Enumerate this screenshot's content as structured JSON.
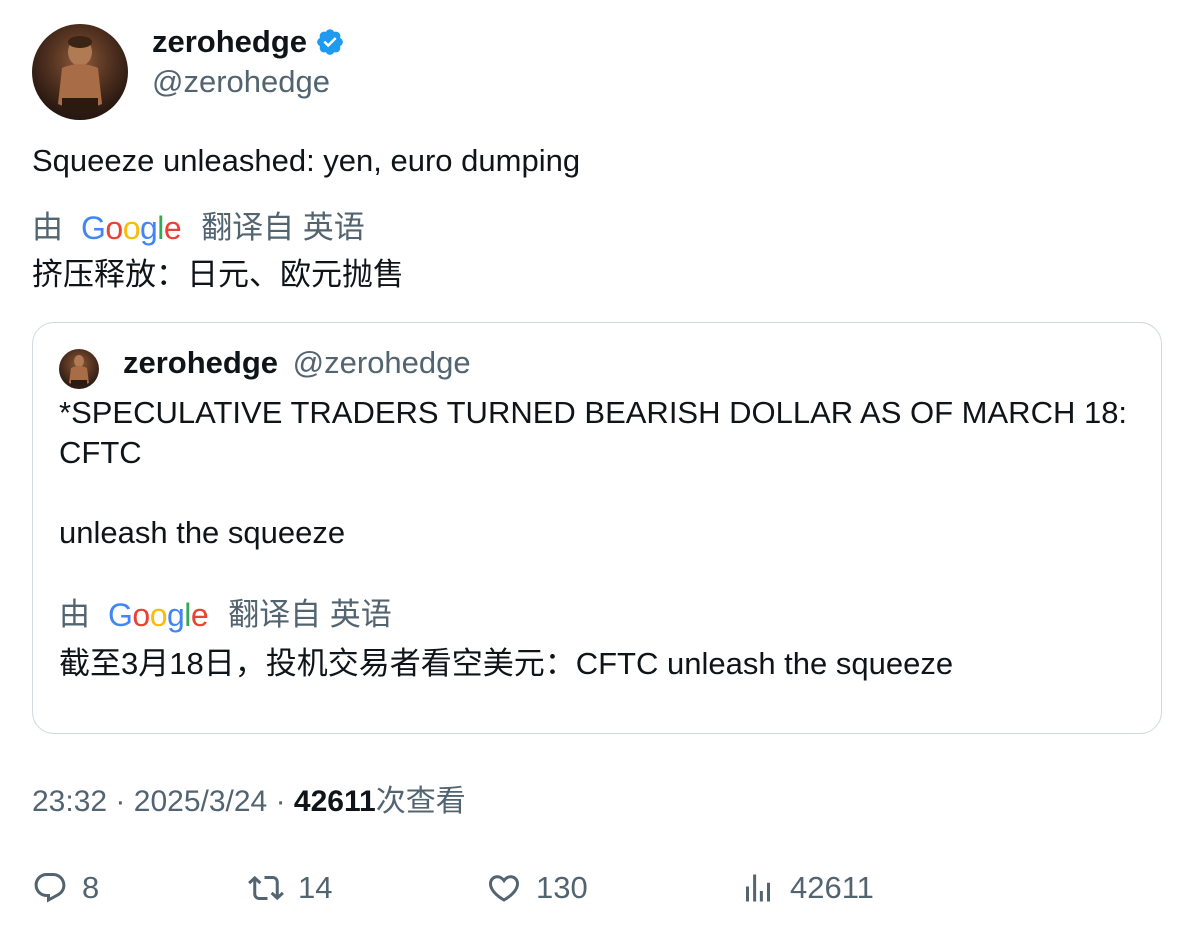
{
  "author": {
    "name": "zerohedge",
    "handle": "@zerohedge",
    "verified": true
  },
  "tweet": {
    "text": "Squeeze unleashed: yen, euro dumping",
    "translation": {
      "by": "由",
      "provider": "Google",
      "from_label": "翻译自 英语",
      "text": "挤压释放：日元、欧元抛售"
    }
  },
  "quote": {
    "name": "zerohedge",
    "handle": "@zerohedge",
    "line1": "*SPECULATIVE TRADERS TURNED BEARISH DOLLAR AS OF MARCH 18: CFTC",
    "line2": "unleash the squeeze",
    "translation": {
      "by": "由",
      "provider": "Google",
      "from_label": "翻译自 英语",
      "text": "截至3月18日，投机交易者看空美元：CFTC unleash the squeeze"
    }
  },
  "meta": {
    "time": "23:32",
    "sep1": "·",
    "date": "2025/3/24",
    "sep2": "·",
    "views_count": "42611",
    "views_label": "次查看"
  },
  "actions": {
    "replies": "8",
    "retweets": "14",
    "likes": "130",
    "views": "42611"
  },
  "colors": {
    "text": "#0f1419",
    "muted": "#536471",
    "verified": "#1d9bf0",
    "border": "#cfd9de"
  },
  "icons": [
    "verified-badge-icon",
    "reply-icon",
    "retweet-icon",
    "like-icon",
    "views-icon"
  ]
}
